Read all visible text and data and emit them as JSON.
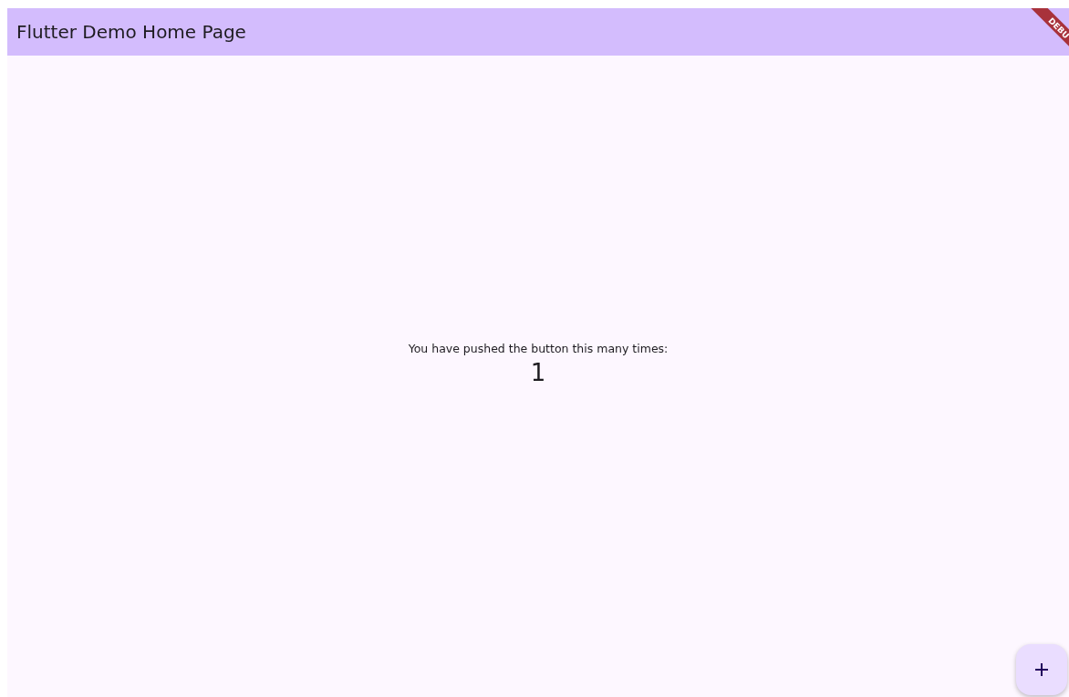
{
  "app_bar": {
    "title": "Flutter Demo Home Page"
  },
  "body": {
    "message": "You have pushed the button this many times:",
    "counter": "1"
  },
  "debug_banner": {
    "label": "DEBU"
  }
}
